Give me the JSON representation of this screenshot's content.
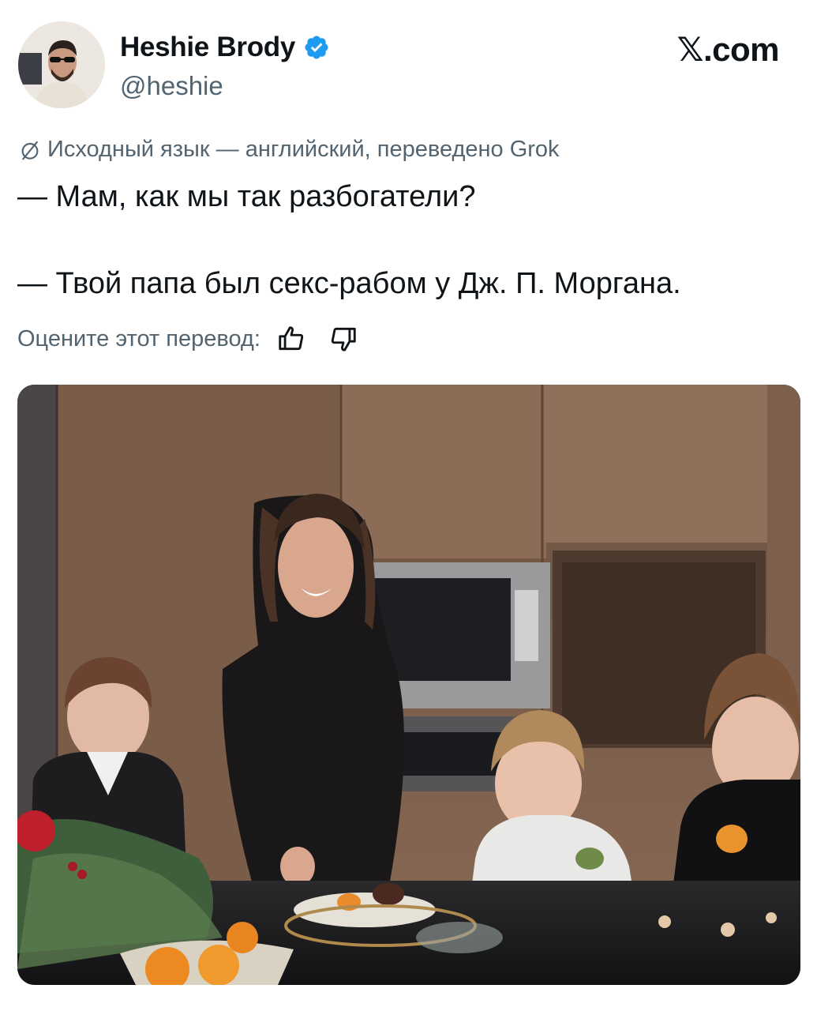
{
  "author": {
    "display_name": "Heshie Brody",
    "handle": "@heshie",
    "verified": true,
    "avatar_icon": "avatar-man-sunglasses"
  },
  "brand": {
    "label": ".com",
    "x_glyph": "𝕏"
  },
  "translation": {
    "note": "Исходный язык — английский, переведено Grok",
    "icon": "translate-icon"
  },
  "tweet": {
    "line1": "— Мам, как мы так разбогатели?",
    "line2": "— Твой папа был секс-рабом у Дж. П. Моргана."
  },
  "rating": {
    "label": "Оцените этот перевод:",
    "like_icon": "thumbs-up-icon",
    "dislike_icon": "thumbs-down-icon"
  },
  "colors": {
    "text": "#0f1419",
    "muted": "#536471",
    "verified": "#1d9bf0"
  }
}
